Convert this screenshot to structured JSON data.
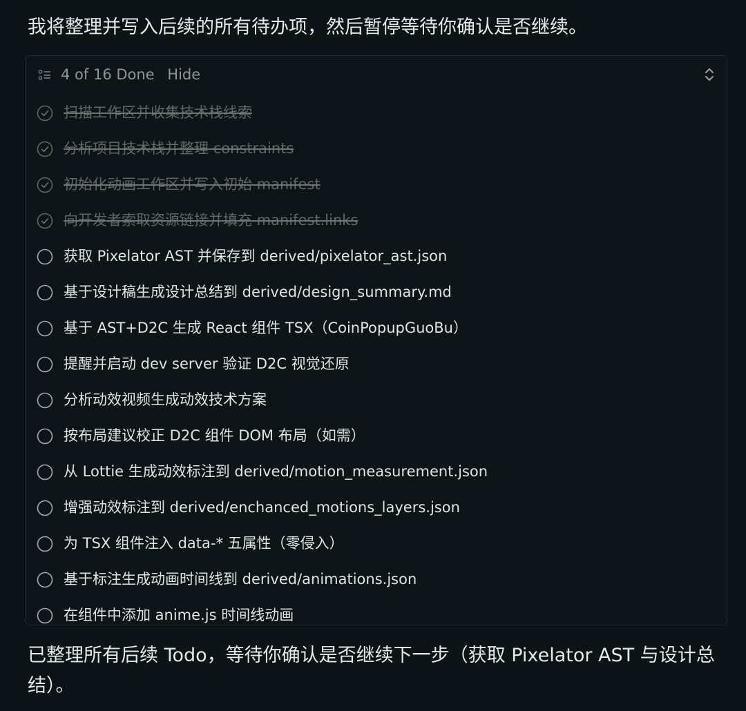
{
  "intro_text": "我将整理并写入后续的所有待办项，然后暂停等待你确认是否继续。",
  "todo_panel": {
    "progress_text": "4 of 16 Done",
    "hide_label": "Hide",
    "icons": {
      "list": "list-icon",
      "expand": "chevron-up-down-icon",
      "done": "check-circle-icon",
      "pending": "empty-circle-icon"
    },
    "items": [
      {
        "label": "扫描工作区并收集技术栈线索",
        "done": true
      },
      {
        "label": "分析项目技术栈并整理 constraints",
        "done": true
      },
      {
        "label": "初始化动画工作区并写入初始 manifest",
        "done": true
      },
      {
        "label": "向开发者索取资源链接并填充 manifest.links",
        "done": true
      },
      {
        "label": "获取 Pixelator AST 并保存到 derived/pixelator_ast.json",
        "done": false
      },
      {
        "label": "基于设计稿生成设计总结到 derived/design_summary.md",
        "done": false
      },
      {
        "label": "基于 AST+D2C 生成 React 组件 TSX（CoinPopupGuoBu）",
        "done": false
      },
      {
        "label": "提醒并启动 dev server 验证 D2C 视觉还原",
        "done": false
      },
      {
        "label": "分析动效视频生成动效技术方案",
        "done": false
      },
      {
        "label": "按布局建议校正 D2C 组件 DOM 布局（如需）",
        "done": false
      },
      {
        "label": "从 Lottie 生成动效标注到 derived/motion_measurement.json",
        "done": false
      },
      {
        "label": "增强动效标注到 derived/enchanced_motions_layers.json",
        "done": false
      },
      {
        "label": "为 TSX 组件注入 data-* 五属性（零侵入）",
        "done": false
      },
      {
        "label": "基于标注生成动画时间线到 derived/animations.json",
        "done": false
      },
      {
        "label": "在组件中添加 anime.js 时间线动画",
        "done": false
      }
    ]
  },
  "outro_text": "已整理所有后续 Todo，等待你确认是否继续下一步（获取 Pixelator AST 与设计总结）。",
  "colors": {
    "background": "#0b1416",
    "panel_border": "#1f2b2e",
    "text_primary": "#dfe3e4",
    "text_muted": "#8d9597",
    "text_done": "#5f6769"
  }
}
